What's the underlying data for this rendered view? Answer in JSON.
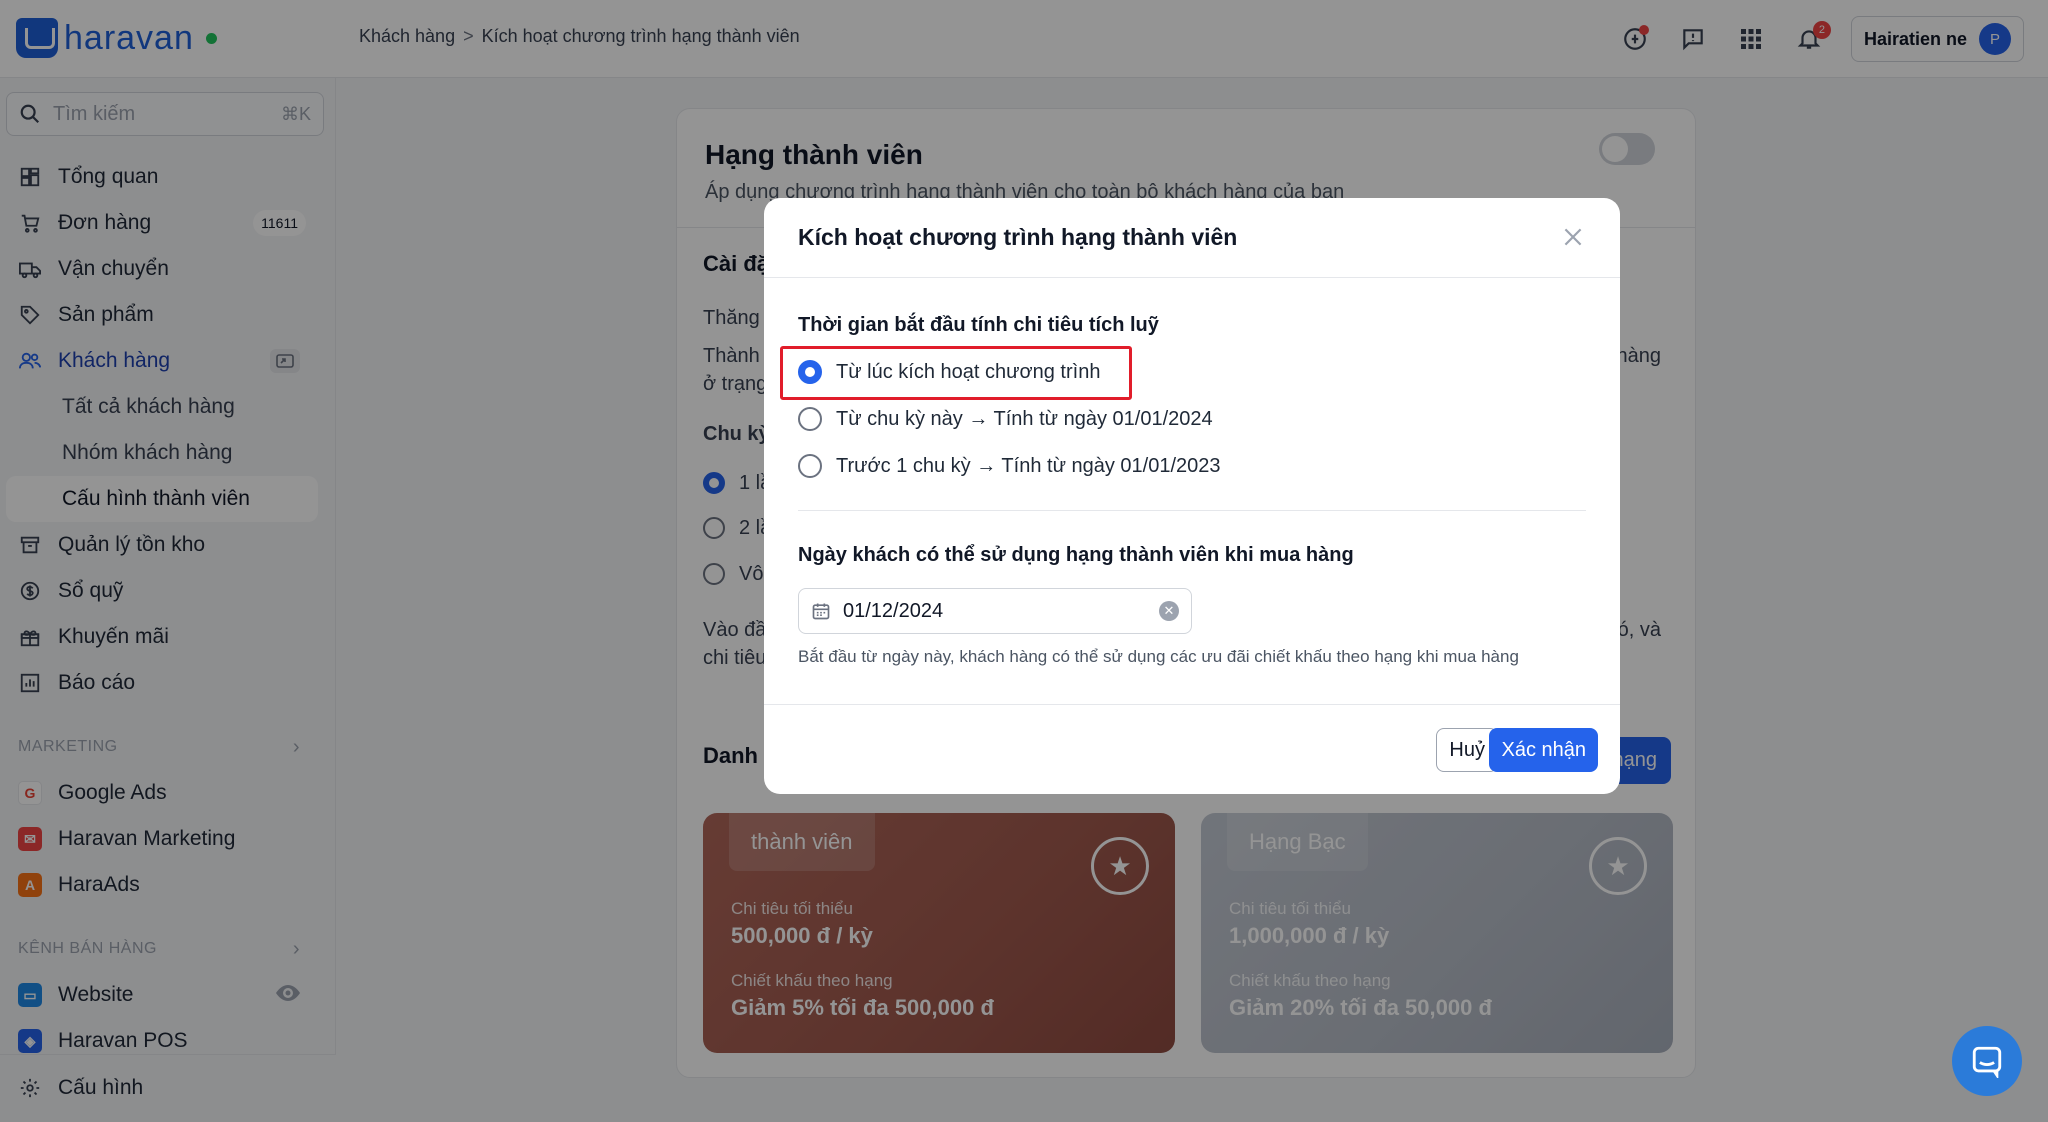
{
  "brand": {
    "name": "haravan"
  },
  "breadcrumb": {
    "parent": "Khách hàng",
    "separator": ">",
    "current": "Kích hoạt chương trình hạng thành viên"
  },
  "topbar": {
    "notification_count": "2",
    "user_name": "Hairatien ne",
    "avatar_initial": "P"
  },
  "search": {
    "placeholder": "Tìm kiếm",
    "shortcut": "⌘K"
  },
  "sidebar": {
    "items": [
      {
        "label": "Tổng quan",
        "icon": "dashboard-icon"
      },
      {
        "label": "Đơn hàng",
        "icon": "cart-icon",
        "badge": "11611"
      },
      {
        "label": "Vận chuyển",
        "icon": "truck-icon"
      },
      {
        "label": "Sản phẩm",
        "icon": "tag-icon"
      },
      {
        "label": "Khách hàng",
        "icon": "users-icon"
      }
    ],
    "customer_sub": [
      "Tất cả khách hàng",
      "Nhóm khách hàng",
      "Cấu hình thành viên"
    ],
    "items2": [
      {
        "label": "Quản lý tồn kho",
        "icon": "archive-icon"
      },
      {
        "label": "Sổ quỹ",
        "icon": "dollar-icon"
      },
      {
        "label": "Khuyến mãi",
        "icon": "gift-icon"
      },
      {
        "label": "Báo cáo",
        "icon": "chart-icon"
      }
    ],
    "marketing_title": "MARKETING",
    "marketing": [
      "Google Ads",
      "Haravan Marketing",
      "HaraAds"
    ],
    "channels_title": "KÊNH BÁN HÀNG",
    "channels": [
      "Website",
      "Haravan POS"
    ],
    "settings": "Cấu hình"
  },
  "card": {
    "title": "Hạng thành viên",
    "subtitle": "Áp dụng chương trình hạng thành viên cho toàn bộ khách hàng của bạn",
    "settings_partial": "Cài đặ",
    "upgrade_partial": "Thăng",
    "text1_partial": "Thành",
    "text1_right": "hàng",
    "text2_partial": "ở trạng",
    "cycle_partial": "Chu kỳ",
    "opt1_partial": "1 lầ",
    "opt2_partial": "2 lầ",
    "opt3_partial": "Vô",
    "note1_partial": "Vào đầ",
    "note1_right": "ó, và",
    "note2_partial": "chi tiêu",
    "list_partial": "Danh",
    "add_btn_partial": "hạng"
  },
  "tiers": [
    {
      "name": "thành viên",
      "min_label": "Chi tiêu tối thiểu",
      "min_value": "500,000 đ / kỳ",
      "disc_label": "Chiết khấu theo hạng",
      "disc_value": "Giảm 5% tối đa 500,000 đ"
    },
    {
      "name": "Hạng Bạc",
      "min_label": "Chi tiêu tối thiểu",
      "min_value": "1,000,000 đ / kỳ",
      "disc_label": "Chiết khấu theo hạng",
      "disc_value": "Giảm 20% tối đa 50,000 đ"
    }
  ],
  "modal": {
    "title": "Kích hoạt chương trình hạng thành viên",
    "start_label": "Thời gian bắt đầu tính chi tiêu tích luỹ",
    "options": [
      "Từ lúc kích hoạt chương trình",
      "Từ chu kỳ này → Tính từ ngày 01/01/2024",
      "Trước 1 chu kỳ → Tính từ ngày 01/01/2023"
    ],
    "selected_option": 0,
    "use_label": "Ngày khách có thể sử dụng hạng thành viên khi mua hàng",
    "date_value": "01/12/2024",
    "helper": "Bắt đầu từ ngày này, khách hàng có thể sử dụng các ưu đãi chiết khấu theo hạng khi mua hàng",
    "cancel": "Huỷ",
    "confirm": "Xác nhận"
  },
  "colors": {
    "primary": "#2563eb",
    "highlight": "#e11d2a",
    "bronze": "#a15a4e",
    "silver": "#b7bdc8"
  }
}
